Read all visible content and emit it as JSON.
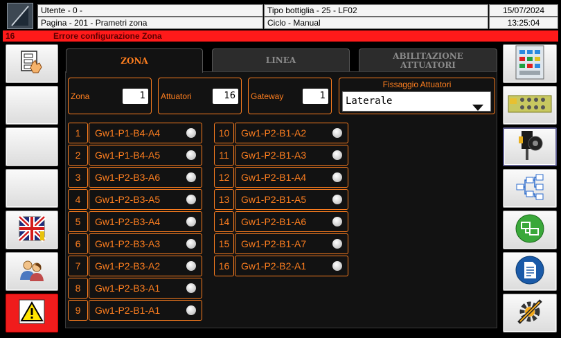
{
  "header": {
    "user": "Utente - 0 -",
    "page": "Pagina - 201 - Prametri zona",
    "bottle_type": "Tipo bottiglia - 25 - LF02",
    "cycle": "Ciclo - Manual",
    "date": "15/07/2024",
    "time": "13:25:04"
  },
  "error": {
    "code": "16",
    "message": "Errore configurazione Zona",
    "color": "#ff1a1a"
  },
  "tabs": [
    {
      "label": "ZONA",
      "active": true
    },
    {
      "label": "LINEA",
      "active": false
    },
    {
      "label": "ABILITAZIONE ATTUATORI",
      "active": false
    }
  ],
  "params": {
    "zona": {
      "label": "Zona",
      "value": "1"
    },
    "attuatori": {
      "label": "Attuatori",
      "value": "16"
    },
    "gateway": {
      "label": "Gateway",
      "value": "1"
    },
    "fissaggio": {
      "label": "Fissaggio Attuatori",
      "value": "Laterale"
    }
  },
  "actuators": [
    {
      "n": "1",
      "name": "Gw1-P1-B4-A4"
    },
    {
      "n": "2",
      "name": "Gw1-P1-B4-A5"
    },
    {
      "n": "3",
      "name": "Gw1-P2-B3-A6"
    },
    {
      "n": "4",
      "name": "Gw1-P2-B3-A5"
    },
    {
      "n": "5",
      "name": "Gw1-P2-B3-A4"
    },
    {
      "n": "6",
      "name": "Gw1-P2-B3-A3"
    },
    {
      "n": "7",
      "name": "Gw1-P2-B3-A2"
    },
    {
      "n": "8",
      "name": "Gw1-P2-B3-A1"
    },
    {
      "n": "9",
      "name": "Gw1-P2-B1-A1"
    },
    {
      "n": "10",
      "name": "Gw1-P2-B1-A2"
    },
    {
      "n": "11",
      "name": "Gw1-P2-B1-A3"
    },
    {
      "n": "12",
      "name": "Gw1-P2-B1-A4"
    },
    {
      "n": "13",
      "name": "Gw1-P2-B1-A5"
    },
    {
      "n": "14",
      "name": "Gw1-P2-B1-A6"
    },
    {
      "n": "15",
      "name": "Gw1-P2-B1-A7"
    },
    {
      "n": "16",
      "name": "Gw1-P2-B2-A1"
    }
  ],
  "left_buttons": [
    "settings-hand-icon",
    "blank",
    "blank",
    "blank",
    "uk-flag-icon",
    "users-icon",
    "warning-icon"
  ],
  "right_buttons": [
    "control-panel-icon",
    "gateway-board-icon",
    "actuator-icon",
    "hierarchy-icon",
    "network-icon",
    "document-icon",
    "tools-gear-icon"
  ],
  "colors": {
    "accent": "#ff7f1f",
    "alarm": "#f01c1c"
  }
}
